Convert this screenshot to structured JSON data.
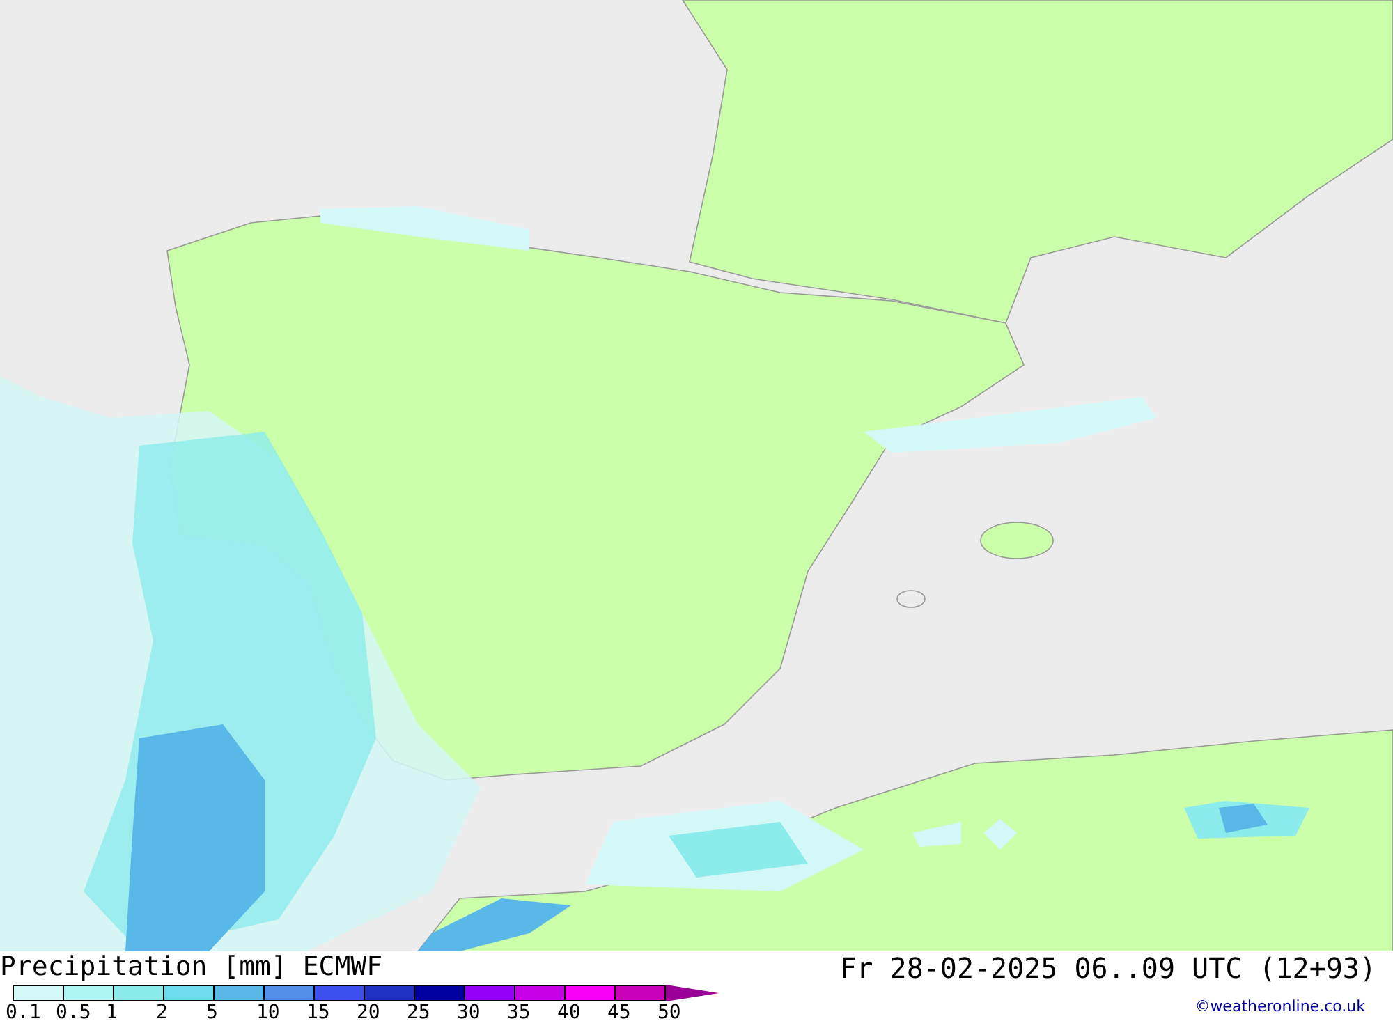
{
  "title": "Precipitation [mm] ECMWF",
  "valid_time": "Fr 28-02-2025 06..09 UTC (12+93)",
  "credit": "©weatheronline.co.uk",
  "legend": {
    "bins": [
      {
        "color": "#d4f7f7"
      },
      {
        "color": "#aef6f6"
      },
      {
        "color": "#8ceceb"
      },
      {
        "color": "#6cdcec"
      },
      {
        "color": "#5ab8e8"
      },
      {
        "color": "#5090e8"
      },
      {
        "color": "#3c50f0"
      },
      {
        "color": "#2030c0"
      },
      {
        "color": "#0000a0"
      },
      {
        "color": "#9400f8"
      },
      {
        "color": "#c800e8"
      },
      {
        "color": "#f800f8"
      },
      {
        "color": "#c800b8"
      },
      {
        "color": "#980098",
        "kind": "arrow"
      }
    ],
    "labels": [
      "0.1",
      "0.5",
      "1",
      "2",
      "5",
      "10",
      "15",
      "20",
      "25",
      "30",
      "35",
      "40",
      "45",
      "50"
    ]
  }
}
